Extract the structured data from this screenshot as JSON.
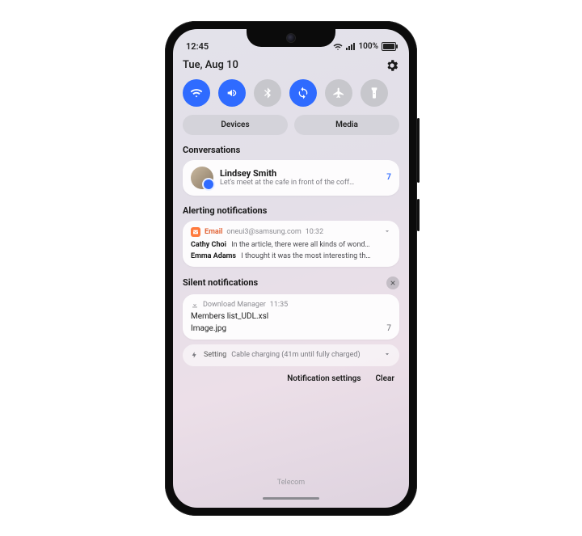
{
  "statusbar": {
    "time": "12:45",
    "battery_pct": "100%"
  },
  "header": {
    "date": "Tue, Aug 10"
  },
  "qs": {
    "wifi_on": true,
    "sound_on": true,
    "bt_on": false,
    "sync_on": true,
    "airplane_on": false,
    "flashlight_on": false
  },
  "chips": {
    "devices": "Devices",
    "media": "Media"
  },
  "sections": {
    "conversations": "Conversations",
    "alerting": "Alerting notifications",
    "silent": "Silent notifications"
  },
  "conversation": {
    "name": "Lindsey Smith",
    "preview": "Let's meet at the cafe in front of the coff…",
    "count": "7"
  },
  "email": {
    "app": "Email",
    "account": "oneui3@samsung.com",
    "time": "10:32",
    "items": [
      {
        "sender": "Cathy Choi",
        "snippet": "In the article, there were all kinds of wond…"
      },
      {
        "sender": "Emma Adams",
        "snippet": "I thought it was the most interesting th…"
      }
    ]
  },
  "download": {
    "app": "Download Manager",
    "time": "11:35",
    "file1": "Members list_UDL.xsl",
    "file2": "Image.jpg",
    "count": "7"
  },
  "charging": {
    "app": "Setting",
    "text": "Cable charging (41m until fully charged)"
  },
  "footer": {
    "settings": "Notification settings",
    "clear": "Clear"
  },
  "carrier": "Telecom"
}
